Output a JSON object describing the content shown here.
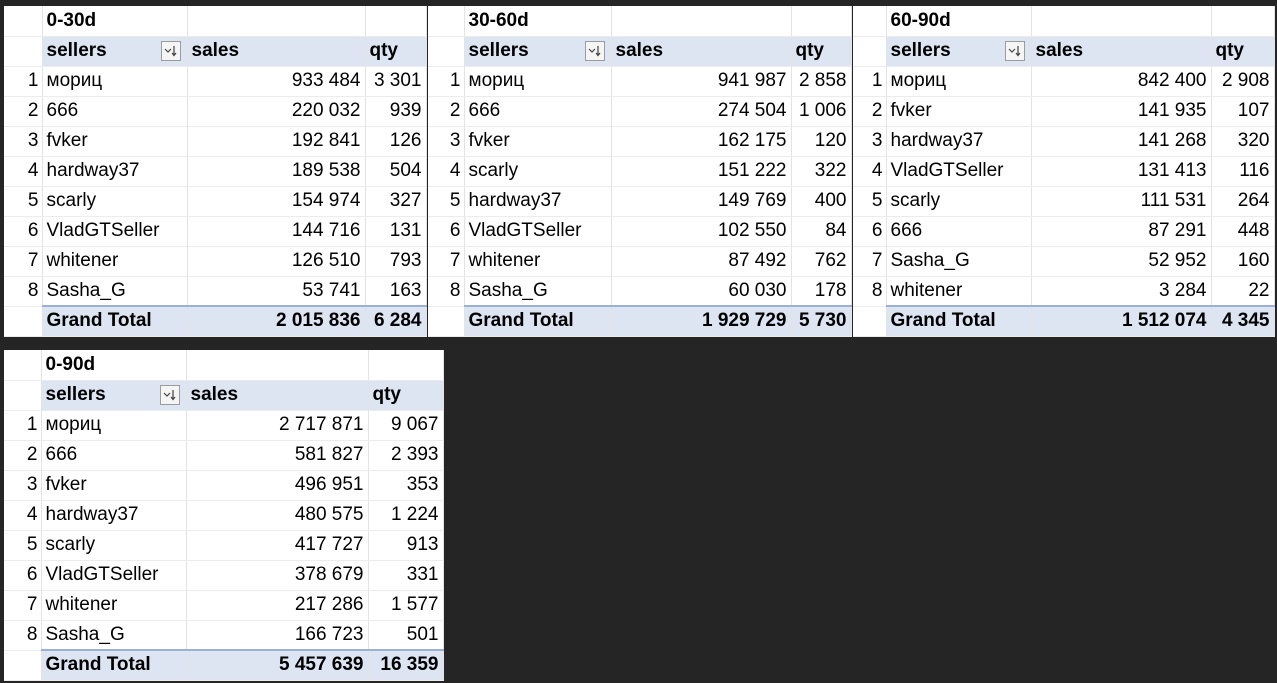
{
  "tables": [
    {
      "title": "0-30d",
      "headers": {
        "sellers": "sellers",
        "sales": "sales",
        "qty": "qty"
      },
      "rows": [
        {
          "n": "1",
          "seller": "мориц",
          "sales": "933 484",
          "qty": "3 301"
        },
        {
          "n": "2",
          "seller": "666",
          "sales": "220 032",
          "qty": "939"
        },
        {
          "n": "3",
          "seller": "fvker",
          "sales": "192 841",
          "qty": "126"
        },
        {
          "n": "4",
          "seller": "hardway37",
          "sales": "189 538",
          "qty": "504"
        },
        {
          "n": "5",
          "seller": "scarly",
          "sales": "154 974",
          "qty": "327"
        },
        {
          "n": "6",
          "seller": "VladGTSeller",
          "sales": "144 716",
          "qty": "131"
        },
        {
          "n": "7",
          "seller": "whitener",
          "sales": "126 510",
          "qty": "793"
        },
        {
          "n": "8",
          "seller": "Sasha_G",
          "sales": "53 741",
          "qty": "163"
        }
      ],
      "total": {
        "label": "Grand Total",
        "sales": "2 015 836",
        "qty": "6 284"
      }
    },
    {
      "title": "30-60d",
      "headers": {
        "sellers": "sellers",
        "sales": "sales",
        "qty": "qty"
      },
      "rows": [
        {
          "n": "1",
          "seller": "мориц",
          "sales": "941 987",
          "qty": "2 858"
        },
        {
          "n": "2",
          "seller": "666",
          "sales": "274 504",
          "qty": "1 006"
        },
        {
          "n": "3",
          "seller": "fvker",
          "sales": "162 175",
          "qty": "120"
        },
        {
          "n": "4",
          "seller": "scarly",
          "sales": "151 222",
          "qty": "322"
        },
        {
          "n": "5",
          "seller": "hardway37",
          "sales": "149 769",
          "qty": "400"
        },
        {
          "n": "6",
          "seller": "VladGTSeller",
          "sales": "102 550",
          "qty": "84"
        },
        {
          "n": "7",
          "seller": "whitener",
          "sales": "87 492",
          "qty": "762"
        },
        {
          "n": "8",
          "seller": "Sasha_G",
          "sales": "60 030",
          "qty": "178"
        }
      ],
      "total": {
        "label": "Grand Total",
        "sales": "1 929 729",
        "qty": "5 730"
      }
    },
    {
      "title": "60-90d",
      "headers": {
        "sellers": "sellers",
        "sales": "sales",
        "qty": "qty"
      },
      "rows": [
        {
          "n": "1",
          "seller": "мориц",
          "sales": "842 400",
          "qty": "2 908"
        },
        {
          "n": "2",
          "seller": "fvker",
          "sales": "141 935",
          "qty": "107"
        },
        {
          "n": "3",
          "seller": "hardway37",
          "sales": "141 268",
          "qty": "320"
        },
        {
          "n": "4",
          "seller": "VladGTSeller",
          "sales": "131 413",
          "qty": "116"
        },
        {
          "n": "5",
          "seller": "scarly",
          "sales": "111 531",
          "qty": "264"
        },
        {
          "n": "6",
          "seller": "666",
          "sales": "87 291",
          "qty": "448"
        },
        {
          "n": "7",
          "seller": "Sasha_G",
          "sales": "52 952",
          "qty": "160"
        },
        {
          "n": "8",
          "seller": "whitener",
          "sales": "3 284",
          "qty": "22"
        }
      ],
      "total": {
        "label": "Grand Total",
        "sales": "1 512 074",
        "qty": "4 345"
      }
    },
    {
      "title": "0-90d",
      "headers": {
        "sellers": "sellers",
        "sales": "sales",
        "qty": "qty"
      },
      "rows": [
        {
          "n": "1",
          "seller": "мориц",
          "sales": "2 717 871",
          "qty": "9 067"
        },
        {
          "n": "2",
          "seller": "666",
          "sales": "581 827",
          "qty": "2 393"
        },
        {
          "n": "3",
          "seller": "fvker",
          "sales": "496 951",
          "qty": "353"
        },
        {
          "n": "4",
          "seller": "hardway37",
          "sales": "480 575",
          "qty": "1 224"
        },
        {
          "n": "5",
          "seller": "scarly",
          "sales": "417 727",
          "qty": "913"
        },
        {
          "n": "6",
          "seller": "VladGTSeller",
          "sales": "378 679",
          "qty": "331"
        },
        {
          "n": "7",
          "seller": "whitener",
          "sales": "217 286",
          "qty": "1 577"
        },
        {
          "n": "8",
          "seller": "Sasha_G",
          "sales": "166 723",
          "qty": "501"
        }
      ],
      "total": {
        "label": "Grand Total",
        "sales": "5 457 639",
        "qty": "16 359"
      }
    }
  ]
}
